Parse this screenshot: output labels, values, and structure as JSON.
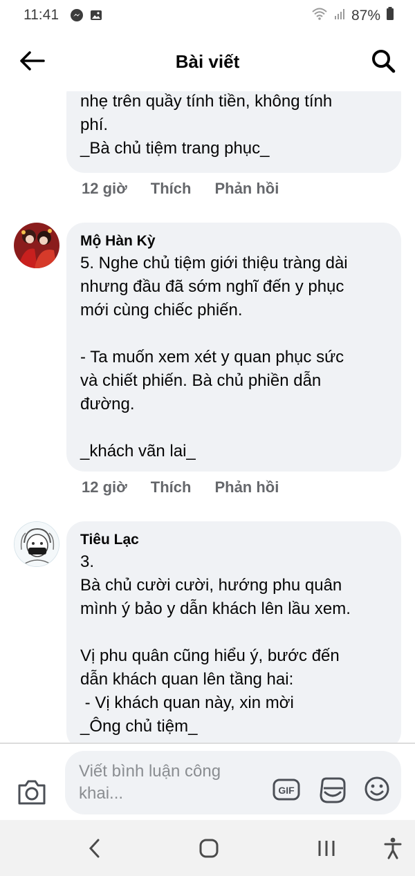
{
  "status_bar": {
    "time": "11:41",
    "battery": "87%"
  },
  "header": {
    "title": "Bài viết"
  },
  "comments": [
    {
      "author": "",
      "text": "nhẹ trên quầy tính tiền, không tính\nphí.\n_Bà chủ tiệm trang phục_",
      "time": "12 giờ",
      "like_label": "Thích",
      "reply_label": "Phản hồi"
    },
    {
      "author": "Mộ Hàn Kỳ",
      "text": "5. Nghe chủ tiệm giới thiệu tràng dài\nnhưng đầu đã sớm nghĩ đến y phục\nmới cùng chiếc phiến.\n\n- Ta muốn xem xét y quan phục sức\nvà chiết phiến. Bà chủ phiền dẫn\nđường.\n\n_khách vãn lai_",
      "time": "12 giờ",
      "like_label": "Thích",
      "reply_label": "Phản hồi"
    },
    {
      "author": "Tiêu Lạc",
      "text": "3.\nBà chủ cười cười, hướng phu quân\nmình ý bảo y dẫn khách lên lầu xem.\n\nVị phu quân cũng hiểu ý, bước đến\ndẫn khách quan lên tầng hai:\n - Vị khách quan này, xin mời\n_Ông chủ tiệm_"
    }
  ],
  "composer": {
    "placeholder": "Viết bình luận công khai...",
    "gif_label": "GIF"
  },
  "colors": {
    "bubble_bg": "#f0f2f5",
    "secondary_text": "#65676b",
    "placeholder_text": "#8a8d91"
  }
}
